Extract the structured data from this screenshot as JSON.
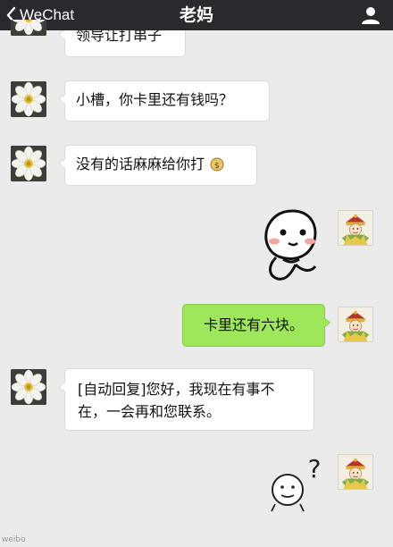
{
  "header": {
    "back_label": "WeChat",
    "title": "老妈",
    "back_icon": "chevron-left-icon",
    "contact_icon": "person-icon",
    "bg_color": "#2a2a2e"
  },
  "messages": [
    {
      "side": "left",
      "text": "领导让打串子",
      "partially_visible": true
    },
    {
      "side": "left",
      "text": "小槽，你卡里还有钱吗？"
    },
    {
      "side": "left",
      "text": "没有的话麻麻给你打",
      "emoji": "money-bag-emoji"
    },
    {
      "side": "right",
      "sticker": "thinking-face-sticker"
    },
    {
      "side": "right",
      "text": "卡里还有六块。"
    },
    {
      "side": "left",
      "text": "[自动回复]您好，我现在有事不在，一会再和您联系。"
    },
    {
      "side": "right",
      "sticker": "confused-face-sticker"
    }
  ],
  "colors": {
    "chat_bg": "#ebebeb",
    "sent_bubble": "#9ee65a",
    "received_bubble": "#ffffff"
  },
  "watermark": "weibo"
}
